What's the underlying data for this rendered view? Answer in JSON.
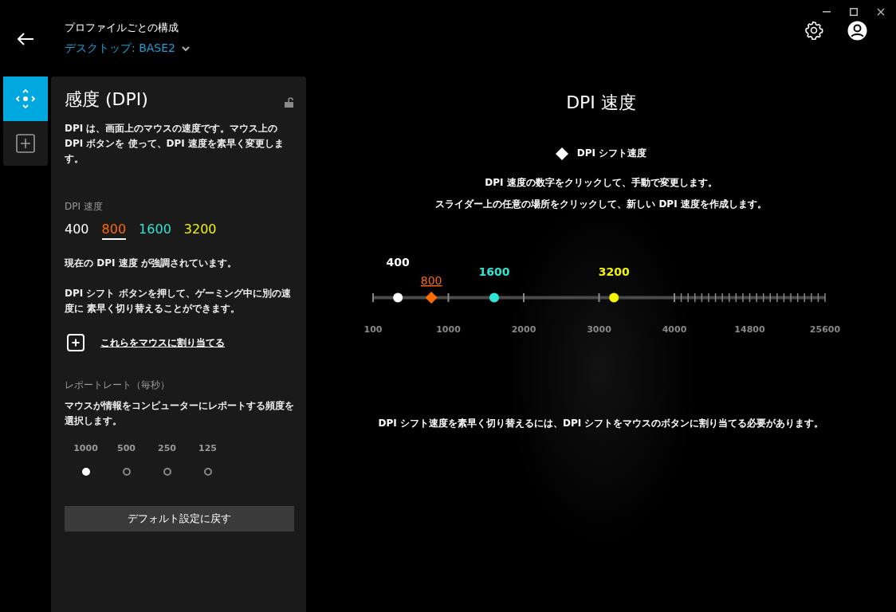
{
  "header": {
    "title": "プロファイルごとの構成",
    "profile": "デスクトップ: BASE2"
  },
  "rail": [
    {
      "kind": "move",
      "selected": true
    },
    {
      "kind": "add",
      "selected": false
    }
  ],
  "panel": {
    "title": "感度 (DPI)",
    "description": "DPI は、画面上のマウスの速度です。マウス上の DPI ボタンを 使って、DPI 速度を素早く変更します。",
    "dpi_label": "DPI 速度",
    "dpi_values": [
      {
        "text": "400",
        "color": "#ffffff",
        "selected": false
      },
      {
        "text": "800",
        "color": "#ff6a00",
        "selected": true
      },
      {
        "text": "1600",
        "color": "#2ee6d6",
        "selected": false
      },
      {
        "text": "3200",
        "color": "#f5f500",
        "selected": false
      }
    ],
    "note_current": "現在の DPI 速度 が強調されています。",
    "note_shift": "DPI シフト ボタンを押して、ゲーミング中に別の速度に 素早く切り替えることができます。",
    "assign_link": "これらをマウスに割り当てる",
    "report_label": "レポートレート（毎秒）",
    "report_description": "マウスが情報をコンピューターにレポートする頻度を選択します。",
    "rates": [
      {
        "label": "1000",
        "selected": true
      },
      {
        "label": "500",
        "selected": false
      },
      {
        "label": "250",
        "selected": false
      },
      {
        "label": "125",
        "selected": false
      }
    ],
    "reset_button": "デフォルト設定に戻す"
  },
  "main": {
    "title": "DPI 速度",
    "legend": "DPI シフト速度",
    "instructions": [
      "DPI 速度の数字をクリックして、手動で変更します。",
      "スライダー上の任意の場所をクリックして、新しい DPI 速度を作成します。"
    ],
    "slider": {
      "ticks": [
        "100",
        "1000",
        "2000",
        "3000",
        "4000",
        "14800",
        "25600"
      ],
      "points": [
        {
          "value": "400",
          "color": "#ffffff",
          "kind": "dot",
          "selected": false,
          "level": 0.055
        },
        {
          "value": "800",
          "color": "#ff6a00",
          "kind": "shift",
          "selected": true,
          "level": 0.129
        },
        {
          "value": "1600",
          "color": "#2ee6d6",
          "kind": "dot",
          "selected": false,
          "level": 0.268
        },
        {
          "value": "3200",
          "color": "#f5f500",
          "kind": "dot",
          "selected": false,
          "level": 0.533
        }
      ]
    },
    "footer": "DPI シフト速度を素早く切り替えるには、DPI シフトをマウスのボタンに割り当てる必要があります。"
  }
}
